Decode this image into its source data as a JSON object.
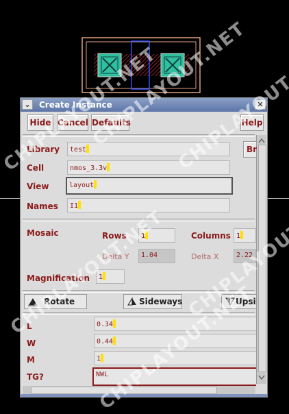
{
  "window": {
    "title": "Create Instance"
  },
  "buttons": {
    "hide": "Hide",
    "cancel": "Cancel",
    "defaults": "Defaults",
    "help": "Help",
    "browse": "Br"
  },
  "fields": {
    "library": {
      "label": "Library",
      "value": "test"
    },
    "cell": {
      "label": "Cell",
      "value": "nmos_3.3v"
    },
    "view": {
      "label": "View",
      "value": "layout"
    },
    "names": {
      "label": "Names",
      "value": "I1"
    }
  },
  "mosaic": {
    "label": "Mosaic",
    "rows_label": "Rows",
    "rows_value": "1",
    "columns_label": "Columns",
    "columns_value": "1",
    "delta_y_label": "Delta Y",
    "delta_y_value": "1.04",
    "delta_x_label": "Delta X",
    "delta_x_value": "2.22"
  },
  "magnification": {
    "label": "Magnification",
    "value": "1"
  },
  "tools": {
    "rotate": "Rotate",
    "sideways": "Sideways",
    "upside": "Upsic"
  },
  "params": {
    "l": {
      "label": "L",
      "value": "0.34"
    },
    "w": {
      "label": "W",
      "value": "0.44"
    },
    "m": {
      "label": "M",
      "value": "1"
    },
    "tg": {
      "label": "TG?",
      "value": "NWL"
    }
  },
  "watermark": "CHIPLAYOUT.NET",
  "icons": {
    "menu": "chevron-down-icon",
    "close": "close-icon",
    "rotate": "rotate-icon",
    "sideways": "sideways-icon",
    "upside": "upside-down-icon"
  }
}
